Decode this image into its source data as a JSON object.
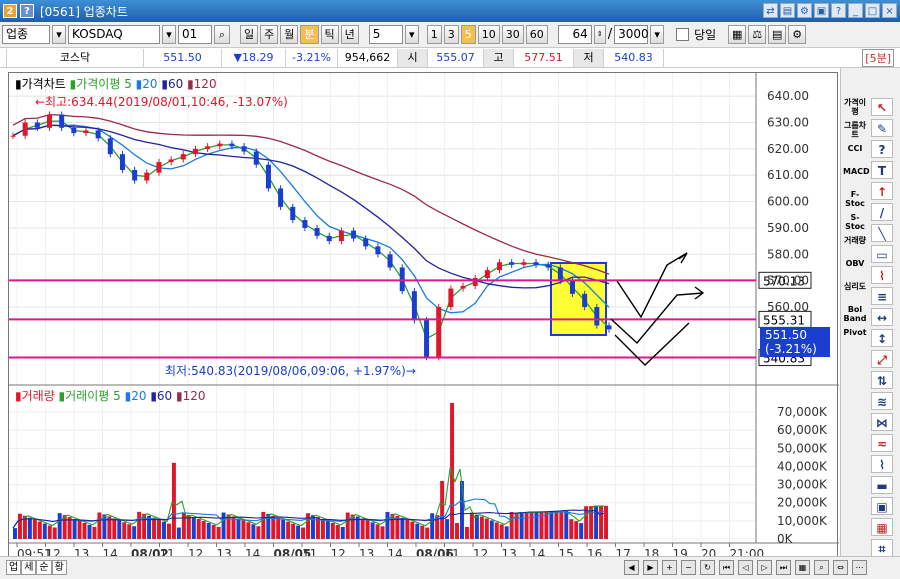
{
  "window": {
    "title": "[0561] 업종차트",
    "num_icon": "2",
    "help_icon": "?"
  },
  "toolbar": {
    "category": "업종",
    "market": "KOSDAQ",
    "code": "01",
    "periods": [
      "일",
      "주",
      "월",
      "분",
      "틱",
      "년"
    ],
    "active_period": "분",
    "interval_value": "5",
    "intervals": [
      "1",
      "3",
      "5",
      "10",
      "30",
      "60"
    ],
    "active_interval": "5",
    "count": "64",
    "total": "3000",
    "today_label": "당일"
  },
  "quote": {
    "name": "코스닥",
    "price": "551.50",
    "change": "▼18.29",
    "change_pct": "-3.21%",
    "volume": "954,662",
    "open_label": "시",
    "open": "555.07",
    "high_label": "고",
    "high": "577.51",
    "low_label": "저",
    "low": "540.83",
    "period_badge": "[5분]"
  },
  "price_panel": {
    "legend_price": "가격차트",
    "legend_ma": "가격이평",
    "ma_periods": [
      "5",
      "20",
      "60",
      "120"
    ],
    "max_note": "←최고:634.44(2019/08/01,10:46, -13.07%)",
    "min_note": "최저:540.83(2019/08/06,09:06, +1.97%)→",
    "y_ticks": [
      "640.00",
      "630.00",
      "620.00",
      "610.00",
      "600.00",
      "590.00",
      "580.00",
      "570.00",
      "560.00"
    ],
    "hline_labels": [
      "570.13",
      "555.31",
      "540.83"
    ],
    "current_price": "551.50",
    "current_pct": "(-3.21%)"
  },
  "volume_panel": {
    "legend_volume": "거래량",
    "legend_ma": "거래이평",
    "ma_periods": [
      "5",
      "20",
      "60",
      "120"
    ],
    "y_ticks": [
      "70,000K",
      "60,000K",
      "50,000K",
      "40,000K",
      "30,000K",
      "20,000K",
      "10,000K",
      "0K"
    ]
  },
  "x_axis": {
    "labels": [
      "09:51",
      "12",
      "13",
      "14",
      "08/02",
      "11",
      "12",
      "13",
      "14",
      "08/05",
      "11",
      "12",
      "13",
      "14",
      "08/06",
      "11",
      "12",
      "13",
      "14",
      "15",
      "16",
      "17",
      "18",
      "19",
      "20",
      "21:00"
    ]
  },
  "right_tools": [
    "가격이평",
    "그룹차트",
    "CCI",
    "MACD",
    "F-Stoc",
    "S-Stoc",
    "거래량",
    "OBV",
    "심리도",
    "Bol Band",
    "Pivot"
  ],
  "bottom_tabs": [
    "업",
    "세",
    "순",
    "황"
  ],
  "colors": {
    "up": "#e0162b",
    "down": "#1a3fd0",
    "highlight": "#ffff33",
    "hline": "#e0168e",
    "ma5": "#2aa12a",
    "ma20": "#1a7be0",
    "ma60": "#2222a0",
    "ma120": "#9a2a4a"
  },
  "chart_data": {
    "type": "line",
    "title": "",
    "series": [
      {
        "name": "가격",
        "values": [
          625,
          630,
          628,
          633,
          628,
          626,
          627,
          624,
          618,
          612,
          608,
          611,
          615,
          616,
          618,
          620,
          621,
          622,
          621,
          619,
          614,
          605,
          598,
          593,
          590,
          587,
          585,
          589,
          586,
          583,
          580,
          575,
          566,
          555,
          541,
          560,
          567,
          568,
          571,
          574,
          577,
          576,
          577,
          576,
          575,
          570,
          565,
          560,
          553,
          551.5
        ]
      }
    ],
    "y_range": [
      538,
      645
    ],
    "annotations": [
      {
        "text": "최고",
        "value": 634.44,
        "date": "2019/08/01 10:46",
        "pct": "-13.07%"
      },
      {
        "text": "최저",
        "value": 540.83,
        "date": "2019/08/06 09:06",
        "pct": "+1.97%"
      }
    ],
    "horizontal_lines": [
      570.13,
      555.31,
      540.83
    ],
    "volume_y_range_k": [
      0,
      75000
    ]
  }
}
